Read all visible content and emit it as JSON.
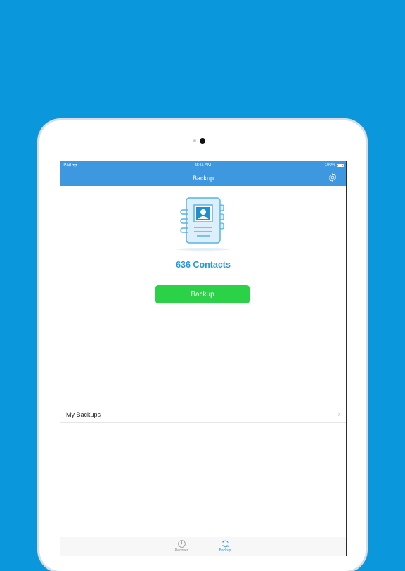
{
  "status_bar": {
    "carrier": "iPad",
    "time": "9:41 AM",
    "battery": "100%"
  },
  "nav": {
    "title": "Backup"
  },
  "main": {
    "contacts_count": "636 Contacts",
    "backup_button": "Backup"
  },
  "list": {
    "my_backups": "My Backups"
  },
  "tabbar": {
    "tabs": [
      {
        "label": "Recover",
        "icon": "clock-icon",
        "active": false
      },
      {
        "label": "Backup",
        "icon": "sync-icon",
        "active": true
      }
    ]
  },
  "colors": {
    "background": "#0a97db",
    "nav": "#3d98df",
    "accent": "#2a97d8",
    "button": "#2bd248"
  }
}
